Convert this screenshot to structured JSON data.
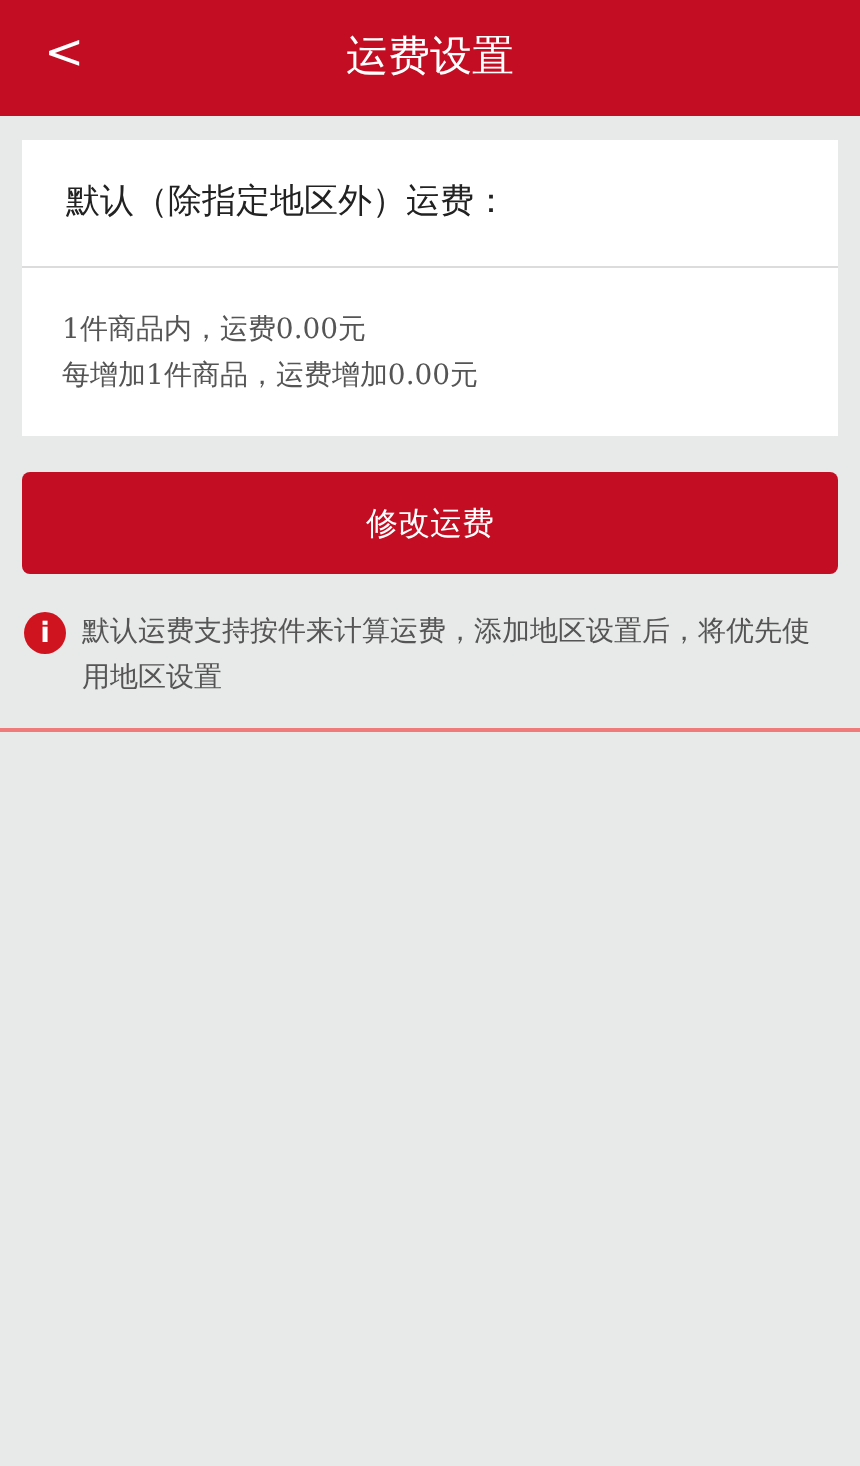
{
  "header": {
    "back": "<",
    "title": "运费设置"
  },
  "card": {
    "title": "默认（除指定地区外）运费：",
    "lines": [
      "1件商品内，运费0.00元",
      "每增加1件商品，运费增加0.00元"
    ]
  },
  "button": "修改运费",
  "notice": {
    "icon": "i",
    "text": "默认运费支持按件来计算运费，添加地区设置后，将优先使用地区设置"
  }
}
